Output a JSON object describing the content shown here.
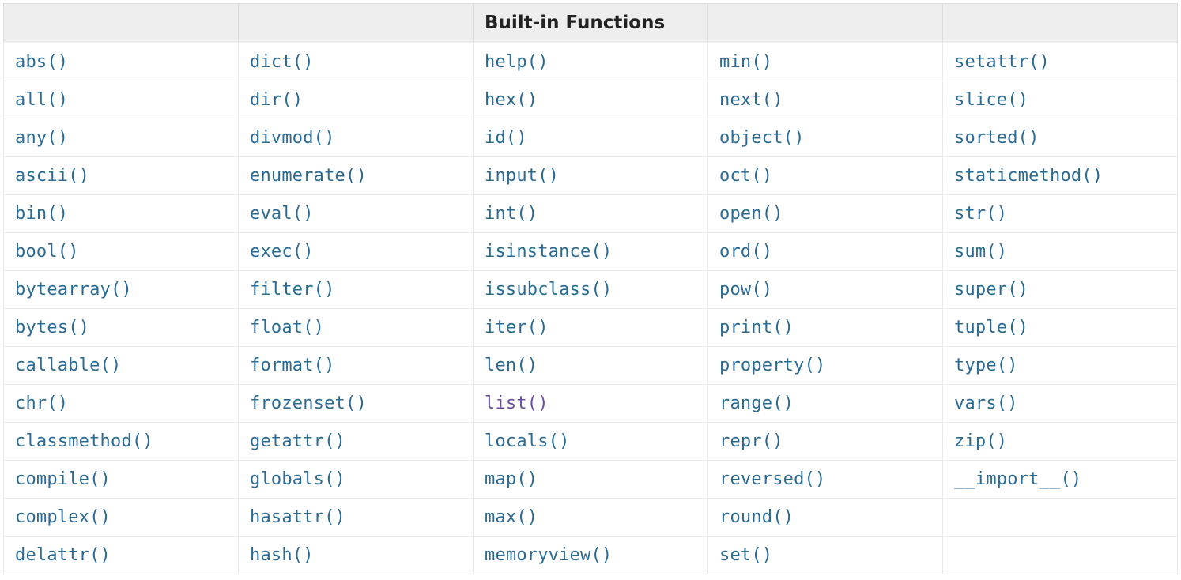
{
  "headers": [
    "",
    "",
    "Built-in Functions",
    "",
    ""
  ],
  "rows": [
    [
      {
        "label": "abs()"
      },
      {
        "label": "dict()"
      },
      {
        "label": "help()"
      },
      {
        "label": "min()"
      },
      {
        "label": "setattr()"
      }
    ],
    [
      {
        "label": "all()"
      },
      {
        "label": "dir()"
      },
      {
        "label": "hex()"
      },
      {
        "label": "next()"
      },
      {
        "label": "slice()"
      }
    ],
    [
      {
        "label": "any()"
      },
      {
        "label": "divmod()"
      },
      {
        "label": "id()"
      },
      {
        "label": "object()"
      },
      {
        "label": "sorted()"
      }
    ],
    [
      {
        "label": "ascii()"
      },
      {
        "label": "enumerate()"
      },
      {
        "label": "input()"
      },
      {
        "label": "oct()"
      },
      {
        "label": "staticmethod()"
      }
    ],
    [
      {
        "label": "bin()"
      },
      {
        "label": "eval()"
      },
      {
        "label": "int()"
      },
      {
        "label": "open()"
      },
      {
        "label": "str()"
      }
    ],
    [
      {
        "label": "bool()"
      },
      {
        "label": "exec()"
      },
      {
        "label": "isinstance()"
      },
      {
        "label": "ord()"
      },
      {
        "label": "sum()"
      }
    ],
    [
      {
        "label": "bytearray()"
      },
      {
        "label": "filter()"
      },
      {
        "label": "issubclass()"
      },
      {
        "label": "pow()"
      },
      {
        "label": "super()"
      }
    ],
    [
      {
        "label": "bytes()"
      },
      {
        "label": "float()"
      },
      {
        "label": "iter()"
      },
      {
        "label": "print()"
      },
      {
        "label": "tuple()"
      }
    ],
    [
      {
        "label": "callable()"
      },
      {
        "label": "format()"
      },
      {
        "label": "len()"
      },
      {
        "label": "property()"
      },
      {
        "label": "type()"
      }
    ],
    [
      {
        "label": "chr()"
      },
      {
        "label": "frozenset()"
      },
      {
        "label": "list()",
        "visited": true
      },
      {
        "label": "range()"
      },
      {
        "label": "vars()"
      }
    ],
    [
      {
        "label": "classmethod()"
      },
      {
        "label": "getattr()"
      },
      {
        "label": "locals()"
      },
      {
        "label": "repr()"
      },
      {
        "label": "zip()"
      }
    ],
    [
      {
        "label": "compile()"
      },
      {
        "label": "globals()"
      },
      {
        "label": "map()"
      },
      {
        "label": "reversed()"
      },
      {
        "label": "__import__()"
      }
    ],
    [
      {
        "label": "complex()"
      },
      {
        "label": "hasattr()"
      },
      {
        "label": "max()"
      },
      {
        "label": "round()"
      },
      {
        "label": ""
      }
    ],
    [
      {
        "label": "delattr()"
      },
      {
        "label": "hash()"
      },
      {
        "label": "memoryview()"
      },
      {
        "label": "set()"
      },
      {
        "label": ""
      }
    ]
  ]
}
